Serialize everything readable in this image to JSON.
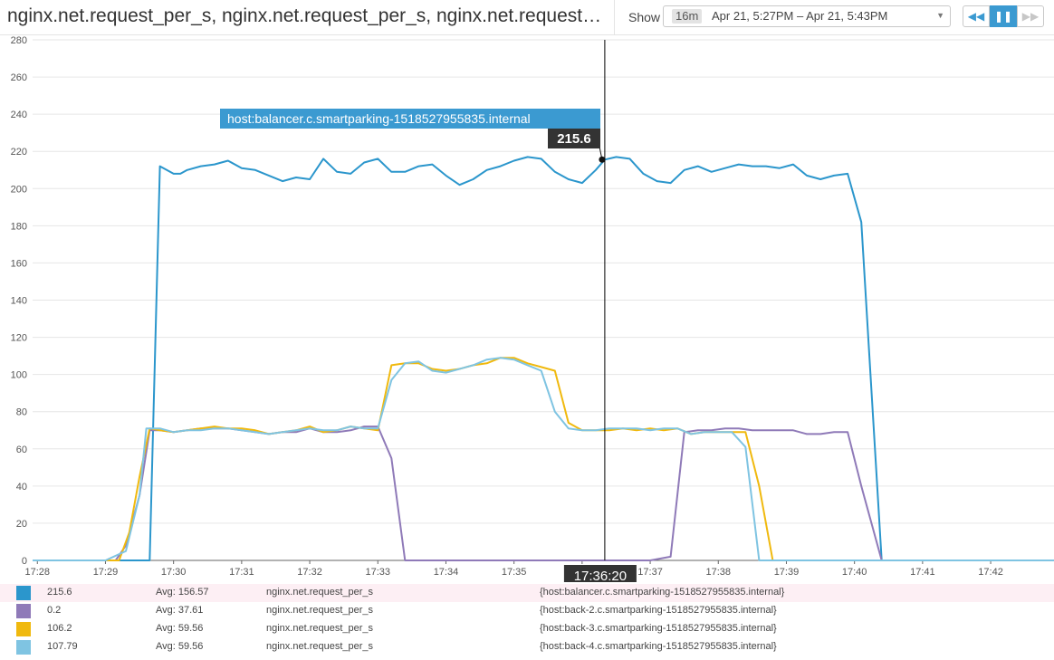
{
  "header": {
    "title": "nginx.net.request_per_s, nginx.net.request_per_s, nginx.net.request_per_s, nginx.net.request_per_s",
    "show_label": "Show",
    "time_badge": "16m",
    "time_range": "Apr 21, 5:27PM – Apr 21, 5:43PM",
    "controls": {
      "rewind_icon": "rewind-icon",
      "pause_icon": "pause-icon",
      "forward_icon": "fast-forward-icon"
    }
  },
  "crosshair": {
    "time_label": "17:36:20",
    "hover_value": "215.6",
    "hover_series": "host:balancer.c.smartparking-1518527955835.internal"
  },
  "colors": {
    "accent": "#3b9ad1",
    "highlight_row": "#fdeff4"
  },
  "legend": [
    {
      "value": "215.6",
      "avg": "Avg: 156.57",
      "metric": "nginx.net.request_per_s",
      "tags": "{host:balancer.c.smartparking-1518527955835.internal}",
      "color": "#2b96cc"
    },
    {
      "value": "0.2",
      "avg": "Avg: 37.61",
      "metric": "nginx.net.request_per_s",
      "tags": "{host:back-2.c.smartparking-1518527955835.internal}",
      "color": "#8f7ab8"
    },
    {
      "value": "106.2",
      "avg": "Avg: 59.56",
      "metric": "nginx.net.request_per_s",
      "tags": "{host:back-3.c.smartparking-1518527955835.internal}",
      "color": "#f0b90e"
    },
    {
      "value": "107.79",
      "avg": "Avg: 59.56",
      "metric": "nginx.net.request_per_s",
      "tags": "{host:back-4.c.smartparking-1518527955835.internal}",
      "color": "#7fc4e2"
    }
  ],
  "chart_data": {
    "type": "line",
    "title": "",
    "xlabel": "",
    "ylabel": "",
    "x_ticks": [
      "17:28",
      "17:29",
      "17:30",
      "17:31",
      "17:32",
      "17:33",
      "17:34",
      "17:35",
      "17:36",
      "17:37",
      "17:38",
      "17:39",
      "17:40",
      "17:41",
      "17:42"
    ],
    "y_ticks": [
      0,
      20,
      40,
      60,
      80,
      100,
      120,
      140,
      160,
      180,
      200,
      220,
      240,
      260,
      280
    ],
    "ylim": [
      0,
      280
    ],
    "xlim_minutes": [
      17.93,
      32.93
    ],
    "grid": true,
    "crosshair_x": 36.333,
    "series": [
      {
        "color": "#2b96cc",
        "points": [
          [
            27.93,
            0
          ],
          [
            28.5,
            0
          ],
          [
            29.0,
            0
          ],
          [
            29.15,
            0
          ],
          [
            29.25,
            0
          ],
          [
            29.5,
            0
          ],
          [
            29.65,
            0
          ],
          [
            29.8,
            212
          ],
          [
            30.0,
            208
          ],
          [
            30.1,
            208
          ],
          [
            30.2,
            210
          ],
          [
            30.4,
            212
          ],
          [
            30.6,
            213
          ],
          [
            30.8,
            215
          ],
          [
            31.0,
            211
          ],
          [
            31.2,
            210
          ],
          [
            31.4,
            207
          ],
          [
            31.6,
            204
          ],
          [
            31.8,
            206
          ],
          [
            32.0,
            205
          ],
          [
            32.2,
            216
          ],
          [
            32.4,
            209
          ],
          [
            32.6,
            208
          ],
          [
            32.8,
            214
          ],
          [
            33.0,
            216
          ],
          [
            33.2,
            209
          ],
          [
            33.4,
            209
          ],
          [
            33.6,
            212
          ],
          [
            33.8,
            213
          ],
          [
            34.0,
            207
          ],
          [
            34.2,
            202
          ],
          [
            34.4,
            205
          ],
          [
            34.6,
            210
          ],
          [
            34.8,
            212
          ],
          [
            35.0,
            215
          ],
          [
            35.2,
            217
          ],
          [
            35.4,
            216
          ],
          [
            35.6,
            209
          ],
          [
            35.8,
            205
          ],
          [
            36.0,
            203
          ],
          [
            36.2,
            210
          ],
          [
            36.333,
            215.6
          ],
          [
            36.5,
            217
          ],
          [
            36.7,
            216
          ],
          [
            36.9,
            208
          ],
          [
            37.1,
            204
          ],
          [
            37.3,
            203
          ],
          [
            37.5,
            210
          ],
          [
            37.7,
            212
          ],
          [
            37.9,
            209
          ],
          [
            38.1,
            211
          ],
          [
            38.3,
            213
          ],
          [
            38.5,
            212
          ],
          [
            38.7,
            212
          ],
          [
            38.9,
            211
          ],
          [
            39.1,
            213
          ],
          [
            39.3,
            207
          ],
          [
            39.5,
            205
          ],
          [
            39.7,
            207
          ],
          [
            39.9,
            208
          ],
          [
            40.1,
            182
          ],
          [
            40.4,
            0
          ],
          [
            41.0,
            0
          ],
          [
            42.93,
            0
          ]
        ]
      },
      {
        "color": "#8f7ab8",
        "points": [
          [
            27.93,
            0
          ],
          [
            28.5,
            0
          ],
          [
            29.0,
            0
          ],
          [
            29.15,
            0
          ],
          [
            29.3,
            8
          ],
          [
            29.5,
            35
          ],
          [
            29.65,
            70
          ],
          [
            29.8,
            70
          ],
          [
            30.0,
            69
          ],
          [
            30.2,
            70
          ],
          [
            30.4,
            71
          ],
          [
            30.6,
            71
          ],
          [
            30.8,
            71
          ],
          [
            31.0,
            70
          ],
          [
            31.2,
            69
          ],
          [
            31.4,
            68
          ],
          [
            31.6,
            69
          ],
          [
            31.8,
            69
          ],
          [
            32.0,
            71
          ],
          [
            32.2,
            69
          ],
          [
            32.4,
            69
          ],
          [
            32.6,
            70
          ],
          [
            32.8,
            72
          ],
          [
            33.0,
            72
          ],
          [
            33.2,
            55
          ],
          [
            33.4,
            0
          ],
          [
            34.0,
            0
          ],
          [
            35.0,
            0
          ],
          [
            36.0,
            0
          ],
          [
            36.5,
            0
          ],
          [
            37.0,
            0
          ],
          [
            37.3,
            2
          ],
          [
            37.5,
            69
          ],
          [
            37.7,
            70
          ],
          [
            37.9,
            70
          ],
          [
            38.1,
            71
          ],
          [
            38.3,
            71
          ],
          [
            38.5,
            70
          ],
          [
            38.7,
            70
          ],
          [
            38.9,
            70
          ],
          [
            39.1,
            70
          ],
          [
            39.3,
            68
          ],
          [
            39.5,
            68
          ],
          [
            39.7,
            69
          ],
          [
            39.9,
            69
          ],
          [
            40.1,
            40
          ],
          [
            40.4,
            0
          ],
          [
            41.0,
            0
          ],
          [
            42.93,
            0
          ]
        ]
      },
      {
        "color": "#f0b90e",
        "points": [
          [
            27.93,
            0
          ],
          [
            28.5,
            0
          ],
          [
            29.0,
            0
          ],
          [
            29.2,
            0
          ],
          [
            29.35,
            15
          ],
          [
            29.5,
            45
          ],
          [
            29.65,
            71
          ],
          [
            29.8,
            70
          ],
          [
            30.0,
            69
          ],
          [
            30.2,
            70
          ],
          [
            30.4,
            71
          ],
          [
            30.6,
            72
          ],
          [
            30.8,
            71
          ],
          [
            31.0,
            71
          ],
          [
            31.2,
            70
          ],
          [
            31.4,
            68
          ],
          [
            31.6,
            69
          ],
          [
            31.8,
            70
          ],
          [
            32.0,
            72
          ],
          [
            32.2,
            69
          ],
          [
            32.4,
            70
          ],
          [
            32.6,
            72
          ],
          [
            32.8,
            71
          ],
          [
            33.0,
            70
          ],
          [
            33.2,
            105
          ],
          [
            33.4,
            106
          ],
          [
            33.6,
            106
          ],
          [
            33.8,
            103
          ],
          [
            34.0,
            102
          ],
          [
            34.2,
            103
          ],
          [
            34.4,
            105
          ],
          [
            34.6,
            106
          ],
          [
            34.8,
            109
          ],
          [
            35.0,
            109
          ],
          [
            35.2,
            106
          ],
          [
            35.4,
            104
          ],
          [
            35.6,
            102
          ],
          [
            35.8,
            74
          ],
          [
            36.0,
            70
          ],
          [
            36.2,
            70
          ],
          [
            36.4,
            70
          ],
          [
            36.6,
            71
          ],
          [
            36.8,
            70
          ],
          [
            37.0,
            71
          ],
          [
            37.2,
            70
          ],
          [
            37.4,
            71
          ],
          [
            37.6,
            68
          ],
          [
            37.8,
            69
          ],
          [
            38.0,
            69
          ],
          [
            38.2,
            69
          ],
          [
            38.4,
            69
          ],
          [
            38.6,
            40
          ],
          [
            38.8,
            0
          ],
          [
            42.93,
            0
          ]
        ]
      },
      {
        "color": "#7fc4e2",
        "points": [
          [
            27.93,
            0
          ],
          [
            28.5,
            0
          ],
          [
            29.0,
            0
          ],
          [
            29.3,
            5
          ],
          [
            29.5,
            35
          ],
          [
            29.6,
            71
          ],
          [
            29.8,
            71
          ],
          [
            30.0,
            69
          ],
          [
            30.2,
            70
          ],
          [
            30.4,
            70
          ],
          [
            30.6,
            71
          ],
          [
            30.8,
            71
          ],
          [
            31.0,
            70
          ],
          [
            31.2,
            69
          ],
          [
            31.4,
            68
          ],
          [
            31.6,
            69
          ],
          [
            31.8,
            70
          ],
          [
            32.0,
            71
          ],
          [
            32.2,
            70
          ],
          [
            32.4,
            70
          ],
          [
            32.6,
            72
          ],
          [
            32.8,
            71
          ],
          [
            33.0,
            71
          ],
          [
            33.2,
            97
          ],
          [
            33.4,
            106
          ],
          [
            33.6,
            107
          ],
          [
            33.8,
            102
          ],
          [
            34.0,
            101
          ],
          [
            34.2,
            103
          ],
          [
            34.4,
            105
          ],
          [
            34.6,
            108
          ],
          [
            34.8,
            109
          ],
          [
            35.0,
            108
          ],
          [
            35.2,
            105
          ],
          [
            35.4,
            102
          ],
          [
            35.6,
            80
          ],
          [
            35.8,
            71
          ],
          [
            36.0,
            70
          ],
          [
            36.2,
            70
          ],
          [
            36.4,
            71
          ],
          [
            36.6,
            71
          ],
          [
            36.8,
            71
          ],
          [
            37.0,
            70
          ],
          [
            37.2,
            71
          ],
          [
            37.4,
            71
          ],
          [
            37.6,
            68
          ],
          [
            37.8,
            69
          ],
          [
            38.0,
            69
          ],
          [
            38.2,
            69
          ],
          [
            38.4,
            61
          ],
          [
            38.6,
            0
          ],
          [
            39.0,
            0
          ],
          [
            42.93,
            0
          ]
        ]
      }
    ]
  }
}
